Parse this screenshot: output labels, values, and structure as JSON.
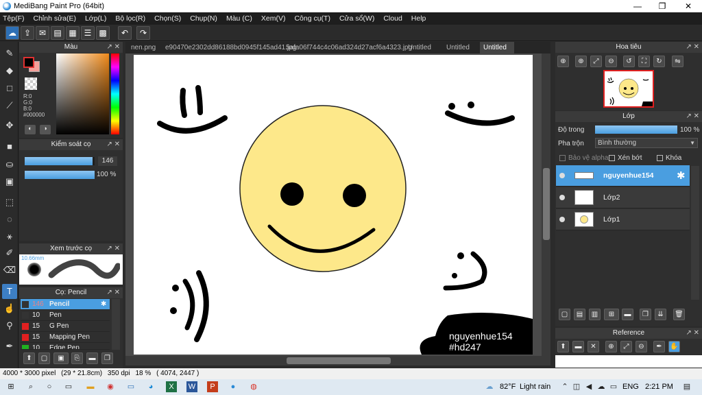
{
  "title": "MediBang Paint Pro (64bit)",
  "window_controls": {
    "minimize": "—",
    "restore": "❐",
    "close": "✕"
  },
  "menu": [
    "Tệp(F)",
    "Chỉnh sửa(E)",
    "Lớp(L)",
    "Bộ lọc(R)",
    "Chọn(S)",
    "Chụp(N)",
    "Màu (C)",
    "Xem(V)",
    "Công cụ(T)",
    "Cửa sổ(W)",
    "Cloud",
    "Help"
  ],
  "tabs": [
    "nen.png",
    "e90470e2302dd86188bd0945f145ad41.jpg",
    "5afa06f744c4c06ad324d27acf6a4323.jpg",
    "Untitled",
    "Untitled",
    "Untitled"
  ],
  "color_panel": {
    "title": "Màu",
    "fg_color": "#000000",
    "bg_color": "#f4a09a",
    "r": "R:0",
    "g": "G:0",
    "b": "B:0",
    "hex": "#000000"
  },
  "brush_control": {
    "title": "Kiểm soát cọ",
    "size": "146",
    "opacity": "100 %",
    "size_fill": 0.97,
    "opacity_fill": 1.0
  },
  "brush_preview": {
    "title": "Xem trước cọ",
    "size_text": "10.66mm"
  },
  "brush_list": {
    "title": "Cọ: Pencil",
    "items": [
      {
        "size": "146",
        "name": "Pencil",
        "color": "#333333",
        "selected": true
      },
      {
        "size": "10",
        "name": "Pen",
        "color": "#333333",
        "selected": false
      },
      {
        "size": "15",
        "name": "G Pen",
        "color": "#e02020",
        "selected": false
      },
      {
        "size": "15",
        "name": "Mapping Pen",
        "color": "#e02020",
        "selected": false
      },
      {
        "size": "10",
        "name": "Edge Pen",
        "color": "#20b020",
        "selected": false
      }
    ]
  },
  "navigator": {
    "title": "Hoa tiêu"
  },
  "layer_panel": {
    "title": "Lớp",
    "opacity_label": "Độ trong",
    "opacity_value": "100 %",
    "opacity_fill": 1.0,
    "blend_label": "Pha trộn",
    "blend_value": "Bình thường",
    "protect_alpha": "Bảo vệ alpha",
    "clipping": "Xén bớt",
    "lock": "Khóa",
    "layers": [
      {
        "name": "nguyenhue154",
        "selected": true
      },
      {
        "name": "Lớp2",
        "selected": false
      },
      {
        "name": "Lớp1",
        "selected": false
      }
    ]
  },
  "reference": {
    "title": "Reference"
  },
  "canvas_text": {
    "line1": "nguyenhue154",
    "line2": "#hd247"
  },
  "status": {
    "dims": "4000 * 3000 pixel",
    "cm": "(29 * 21.8cm)",
    "dpi": "350 dpi",
    "zoom": "18 %",
    "coords": "( 4074, 2447 )"
  },
  "taskbar": {
    "weather_temp": "82°F",
    "weather_desc": "Light rain",
    "lang": "ENG",
    "time": "2:21 PM"
  },
  "icons": [
    "cloud-icon",
    "undo-icon",
    "redo-icon",
    "brush-icon",
    "eraser-icon",
    "move-icon",
    "fill-icon",
    "text-icon",
    "eye-icon",
    "gear-icon"
  ]
}
